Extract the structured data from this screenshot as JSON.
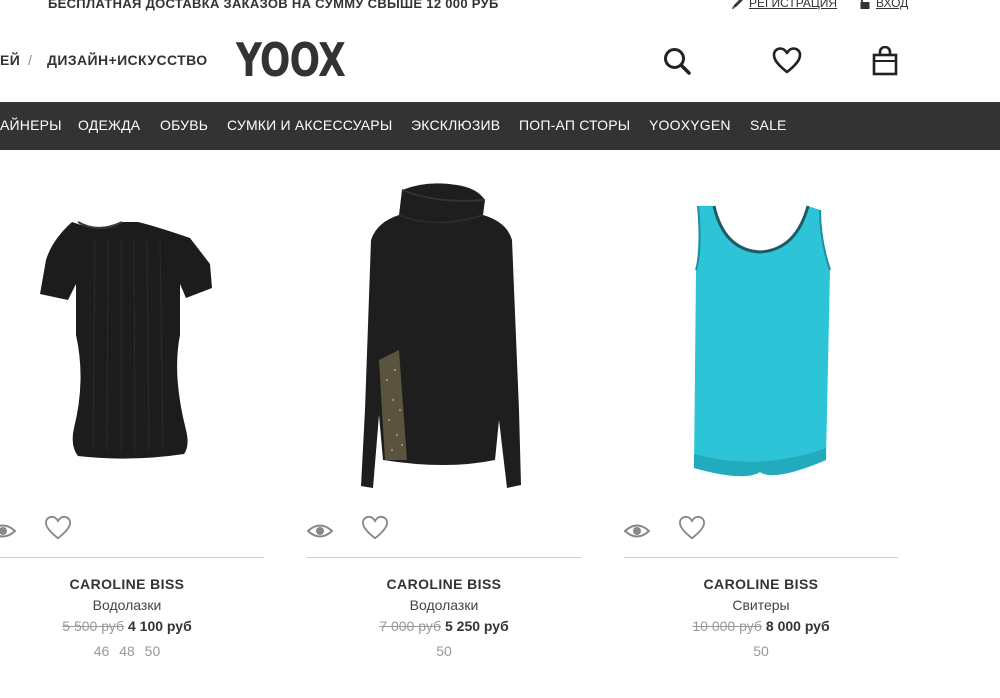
{
  "promo": {
    "text": "БЕСПЛАТНАЯ ДОСТАВКА ЗАКАЗОВ НА СУММУ СВЫШЕ 12 000 РУБ",
    "register": "РЕГИСТРАЦИЯ",
    "login": "ВХОД"
  },
  "header": {
    "crumb_partial": "ЕЙ",
    "separator": "/",
    "crumb_design": "ДИЗАЙН+ИСКУССТВО",
    "logo": "YOOX"
  },
  "nav": {
    "items": [
      "АЙНЕРЫ",
      "ОДЕЖДА",
      "ОБУВЬ",
      "СУМКИ И АКСЕССУАРЫ",
      "ЭКСКЛЮЗИВ",
      "ПОП-АП СТОРЫ",
      "YOOXYGEN",
      "SALE"
    ]
  },
  "products": [
    {
      "brand": "CAROLINE BISS",
      "category": "Водолазки",
      "old_price": "5 500 руб",
      "new_price": "4 100 руб",
      "sizes": "46 48 50",
      "color": "#1c1c1c"
    },
    {
      "brand": "CAROLINE BISS",
      "category": "Водолазки",
      "old_price": "7 000 руб",
      "new_price": "5 250 руб",
      "sizes": "50",
      "color": "#1e1e1e"
    },
    {
      "brand": "CAROLINE BISS",
      "category": "Свитеры",
      "old_price": "10 000 руб",
      "new_price": "8 000 руб",
      "sizes": "50",
      "color": "#2ec4d8"
    }
  ]
}
